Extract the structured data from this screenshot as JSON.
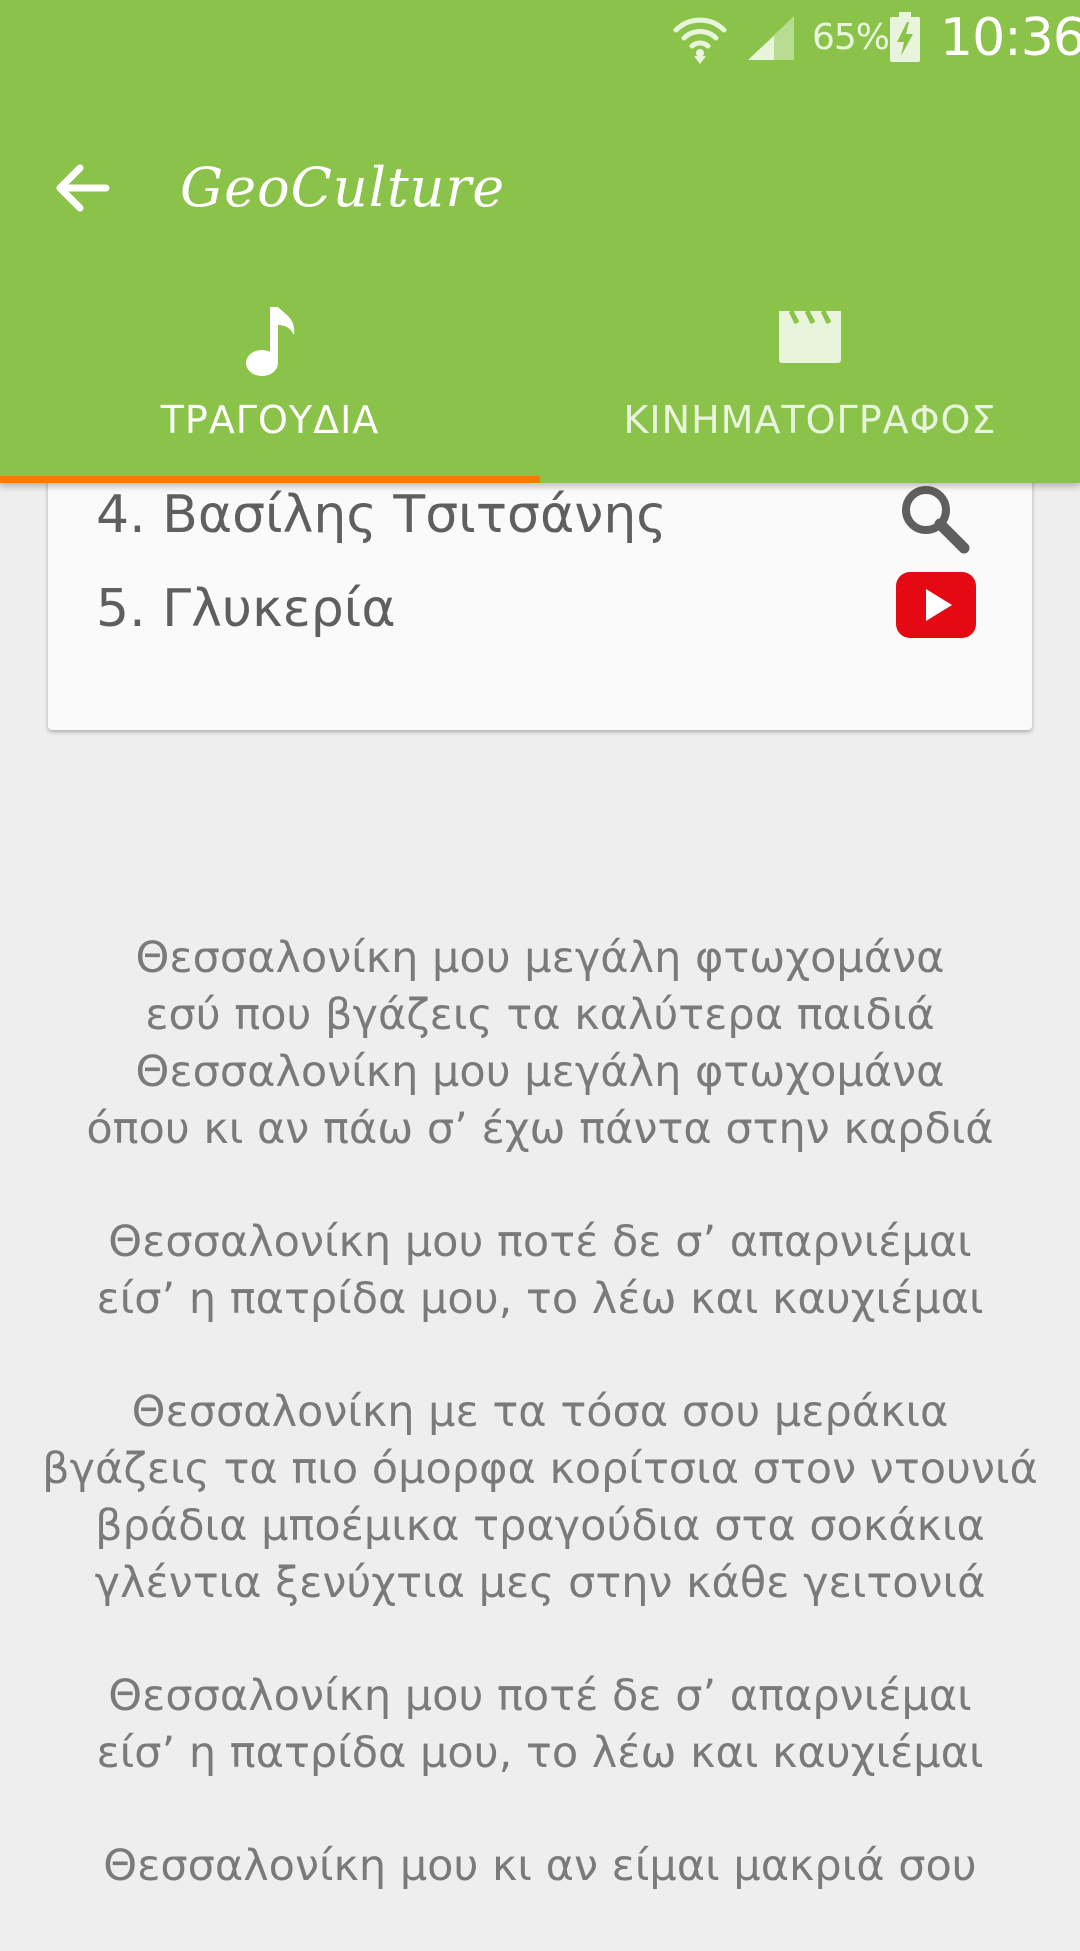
{
  "status_bar": {
    "battery_percent": "65%",
    "time": "10:36",
    "icons": [
      "wifi-icon",
      "cell-signal-icon",
      "battery-charging-icon"
    ]
  },
  "toolbar": {
    "back_icon": "arrow-left-icon",
    "title": "GeoCulture"
  },
  "tabs": [
    {
      "label": "ΤΡΑΓΟΥΔΙΑ",
      "icon": "music-note-icon",
      "selected": true
    },
    {
      "label": "ΚΙΝΗΜΑΤΟΓΡΑΦΟΣ",
      "icon": "movie-clapper-icon",
      "selected": false
    }
  ],
  "card": {
    "rows": [
      {
        "text": "4. Βασίλης Τσιτσάνης",
        "action_icon": "search-icon"
      },
      {
        "text": "5. Γλυκερία",
        "action_icon": "youtube-play-icon"
      }
    ]
  },
  "lyrics": {
    "stanzas": [
      [
        "Θεσσαλονίκη μου μεγάλη φτωχομάνα",
        "εσύ που βγάζεις τα καλύτερα παιδιά",
        "Θεσσαλονίκη μου μεγάλη φτωχομάνα",
        "όπου κι αν πάω σ’ έχω πάντα στην καρδιά"
      ],
      [
        "Θεσσαλονίκη μου ποτέ δε σ’ απαρνιέμαι",
        "είσ’ η πατρίδα μου, το λέω και καυχιέμαι"
      ],
      [
        "Θεσσαλονίκη με τα τόσα σου μεράκια",
        "βγάζεις τα πιο όμορφα κορίτσια στον ντουνιά",
        "βράδια μποέμικα τραγούδια στα σοκάκια",
        "γλέντια ξενύχτια μες στην κάθε γειτονιά"
      ],
      [
        "Θεσσαλονίκη μου ποτέ δε σ’ απαρνιέμαι",
        "είσ’ η πατρίδα μου, το λέω και καυχιέμαι"
      ],
      [
        "Θεσσαλονίκη μου κι αν είμαι μακριά σου"
      ]
    ]
  },
  "colors": {
    "primary": "#8bc34a",
    "tab_indicator": "#f57c00",
    "youtube_red": "#e50914",
    "background": "#eeeeee"
  }
}
